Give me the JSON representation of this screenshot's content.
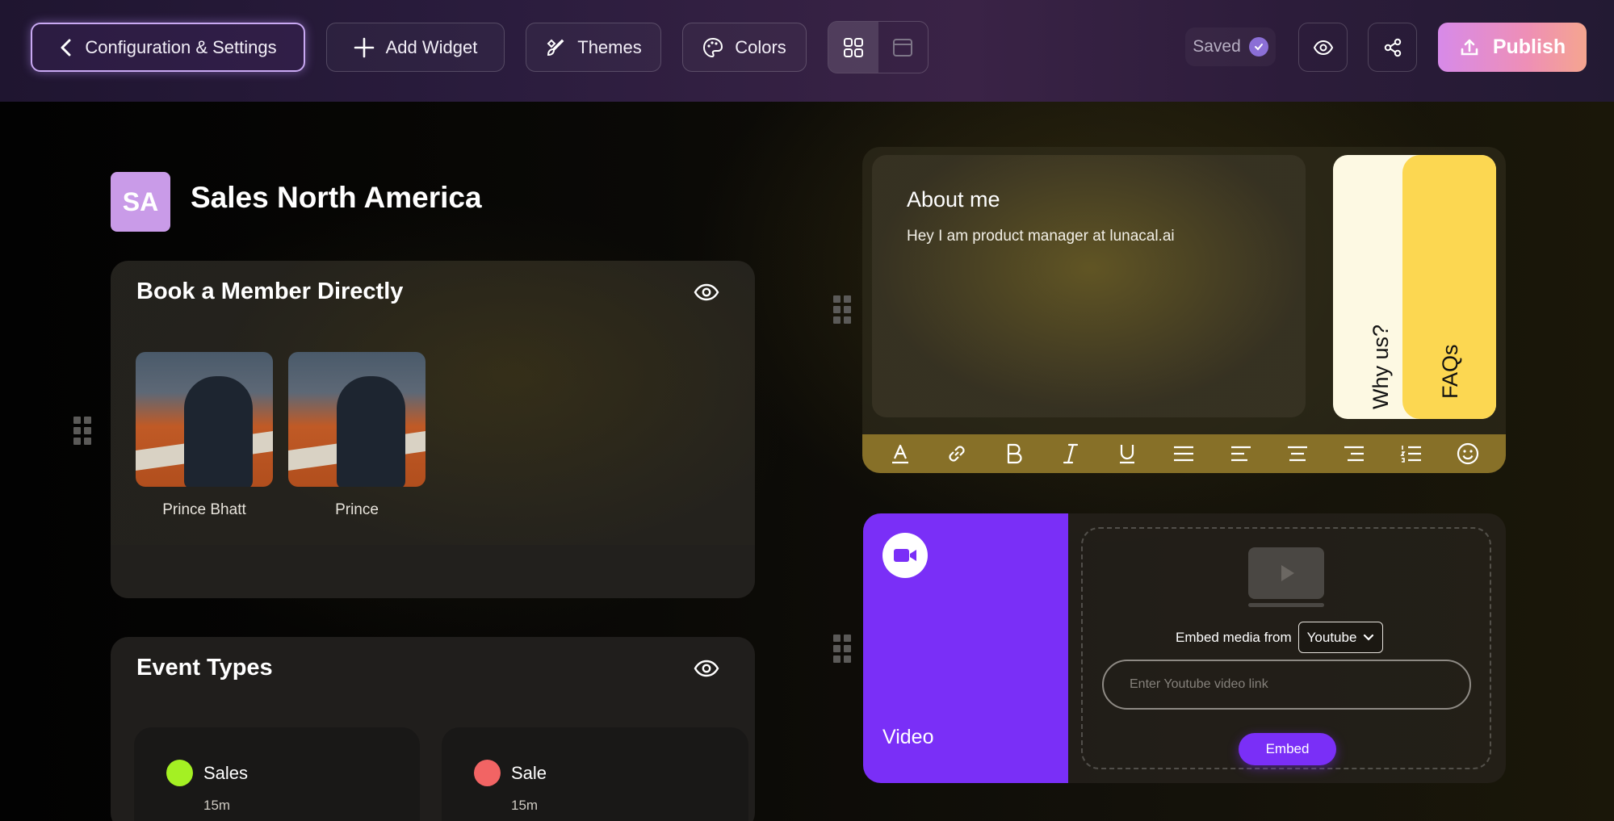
{
  "toolbar": {
    "config_label": "Configuration & Settings",
    "add_widget_label": "Add Widget",
    "themes_label": "Themes",
    "colors_label": "Colors",
    "saved_label": "Saved",
    "publish_label": "Publish"
  },
  "page": {
    "avatar_initials": "SA",
    "title": "Sales North America"
  },
  "book_card": {
    "title": "Book a Member Directly",
    "members": [
      {
        "name": "Prince Bhatt"
      },
      {
        "name": "Prince"
      }
    ]
  },
  "events_card": {
    "title": "Event Types",
    "events": [
      {
        "name": "Sales",
        "duration": "15m",
        "color": "#a4f023"
      },
      {
        "name": "Sale",
        "duration": "15m",
        "color": "#f26464"
      }
    ]
  },
  "about": {
    "title": "About me",
    "text": "Hey I am product manager at lunacal.ai",
    "tabs": [
      "Why us?",
      "FAQs"
    ]
  },
  "video": {
    "label": "Video",
    "embed_from_label": "Embed media from",
    "provider": "Youtube",
    "input_placeholder": "Enter Youtube video link",
    "embed_label": "Embed"
  },
  "colors": {
    "accent_purple": "#7a2ff7",
    "avatar_bg": "#c99be8",
    "tab_yellow": "#fcd751",
    "tab_cream": "#fdf9e3",
    "toolbar_gold": "#877028"
  }
}
